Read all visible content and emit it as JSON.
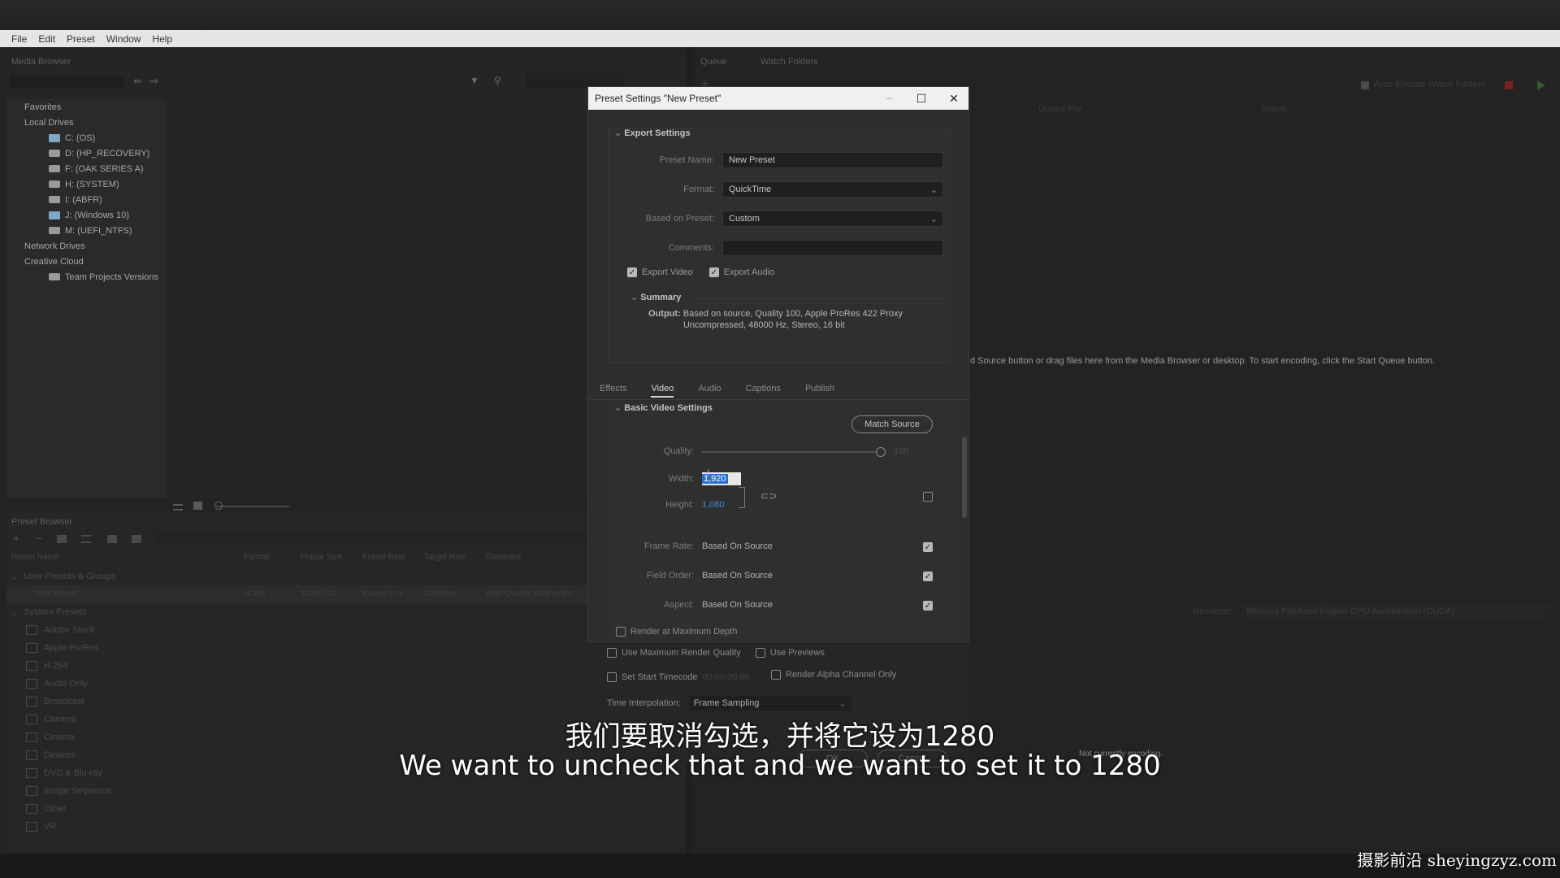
{
  "menu": [
    "File",
    "Edit",
    "Preset",
    "Window",
    "Help"
  ],
  "media_browser": {
    "title": "Media Browser",
    "tree": [
      {
        "label": "Favorites",
        "level": 0,
        "icon": "none"
      },
      {
        "label": "Local Drives",
        "level": 0,
        "icon": "none"
      },
      {
        "label": "C: (OS)",
        "level": 1,
        "icon": "windows-drive-icon"
      },
      {
        "label": "D: (HP_RECOVERY)",
        "level": 1,
        "icon": "drive-icon"
      },
      {
        "label": "F: (OAK SERIES A)",
        "level": 1,
        "icon": "drive-icon"
      },
      {
        "label": "H: (SYSTEM)",
        "level": 1,
        "icon": "drive-icon"
      },
      {
        "label": "I: (ABFR)",
        "level": 1,
        "icon": "usb-icon"
      },
      {
        "label": "J: (Windows 10)",
        "level": 1,
        "icon": "windows-drive-icon"
      },
      {
        "label": "M: (UEFI_NTFS)",
        "level": 1,
        "icon": "drive-icon"
      },
      {
        "label": "Network Drives",
        "level": 0,
        "icon": "none"
      },
      {
        "label": "Creative Cloud",
        "level": 0,
        "icon": "none"
      },
      {
        "label": "Team Projects Versions",
        "level": 1,
        "icon": "team-projects-icon"
      }
    ]
  },
  "preset_browser": {
    "title": "Preset Browser",
    "columns": [
      "Preset Name",
      "Format",
      "Frame Size",
      "Frame Rate",
      "Target Rate",
      "Comment"
    ],
    "groups_label": "User Presets & Groups",
    "user_preset": {
      "name": "New Preset",
      "format": "H.264",
      "frame_size": "1280x720",
      "frame_rate": "Based on s",
      "target_rate": "10 Mbps",
      "comment": "High Quality 480p video"
    },
    "system_label": "System Presets",
    "system_items": [
      "Adobe Stock",
      "Apple ProRes",
      "H.264",
      "Audio Only",
      "Broadcast",
      "Camera",
      "Cinema",
      "Devices",
      "DVD & Blu-ray",
      "Image Sequence",
      "Other",
      "VR"
    ]
  },
  "queue": {
    "tabs": [
      "Queue",
      "Watch Folders"
    ],
    "auto_encode": "Auto-Encode Watch Folders",
    "columns": [
      "Output File",
      "Status"
    ],
    "hint": "d Source button or drag files here from the Media Browser or desktop.  To start encoding, click the Start Queue button.",
    "renderer_label": "Renderer:",
    "renderer_value": "Mercury Playback Engine GPU Acceleration (CUDA)",
    "status": "Not currently encoding."
  },
  "dialog": {
    "title": "Preset Settings \"New Preset\"",
    "export_settings": "Export Settings",
    "preset_name_label": "Preset Name:",
    "preset_name": "New Preset",
    "format_label": "Format:",
    "format": "QuickTime",
    "based_on_label": "Based on Preset:",
    "based_on": "Custom",
    "comments_label": "Comments:",
    "export_video": "Export Video",
    "export_audio": "Export Audio",
    "summary": "Summary",
    "output_label": "Output:",
    "output_line1": "Based on source, Quality 100, Apple ProRes 422 Proxy",
    "output_line2": "Uncompressed, 48000 Hz, Stereo, 16 bit",
    "tabs": [
      "Effects",
      "Video",
      "Audio",
      "Captions",
      "Publish"
    ],
    "active_tab": "Video",
    "basic_video": "Basic Video Settings",
    "match_source": "Match Source",
    "quality_label": "Quality:",
    "quality_value": "100",
    "quality_level": 1.0,
    "width_label": "Width:",
    "width_value": "1,920",
    "height_label": "Height:",
    "height_value": "1,080",
    "frame_rate_label": "Frame Rate:",
    "frame_rate_value": "Based On Source",
    "field_order_label": "Field Order:",
    "field_order_value": "Based On Source",
    "aspect_label": "Aspect:",
    "aspect_value": "Based On Source",
    "render_max_depth": "Render at Maximum Depth",
    "use_max_quality": "Use Maximum Render Quality",
    "use_previews": "Use Previews",
    "set_start_tc": "Set Start Timecode",
    "start_tc_value": "00;00;00;00",
    "render_alpha": "Render Alpha Channel Only",
    "time_interp_label": "Time Interpolation:",
    "time_interp_value": "Frame Sampling",
    "ok": "OK",
    "cancel": "Cancel"
  },
  "subtitles": {
    "cn": "我们要取消勾选，并将它设为1280",
    "en": "We want to uncheck that and we want to set it to 1280"
  },
  "watermark": "摄影前沿 sheyingzyz.com"
}
